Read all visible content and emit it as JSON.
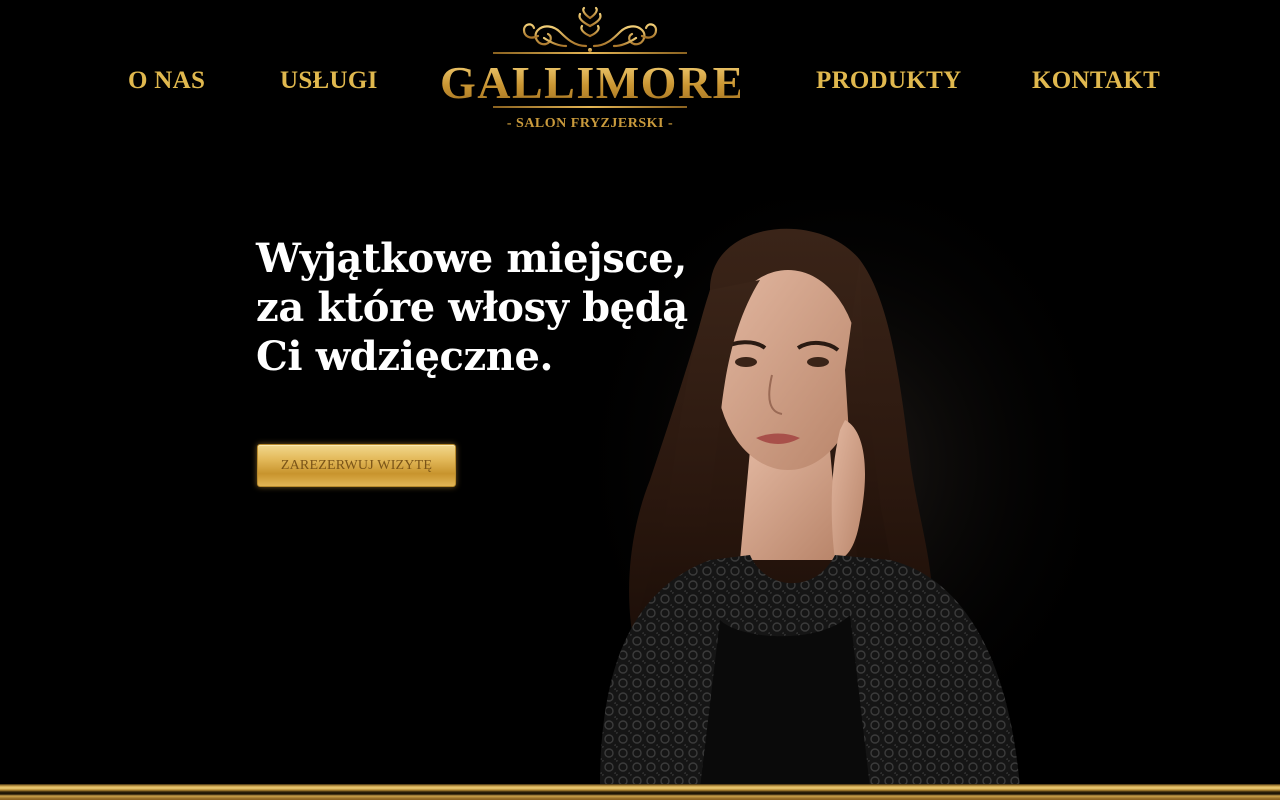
{
  "nav": {
    "left": [
      {
        "label": "O NAS"
      },
      {
        "label": "USŁUGI"
      }
    ],
    "right": [
      {
        "label": "PRODUKTY"
      },
      {
        "label": "KONTAKT"
      }
    ]
  },
  "logo": {
    "name": "GALLIMORE",
    "tagline": "- SALON FRYZJERSKI -"
  },
  "hero": {
    "headline_lines": [
      "Wyjątkowe miejsce,",
      "za które włosy będą",
      "Ci wdzięczne."
    ],
    "cta_label": "ZAREZERWUJ WIZYTĘ"
  },
  "colors": {
    "background": "#000000",
    "accent_gold": "#e0b84e",
    "headline": "#ffffff"
  },
  "icons": {
    "logo_ornament": "baroque-scroll-ornament-icon"
  }
}
